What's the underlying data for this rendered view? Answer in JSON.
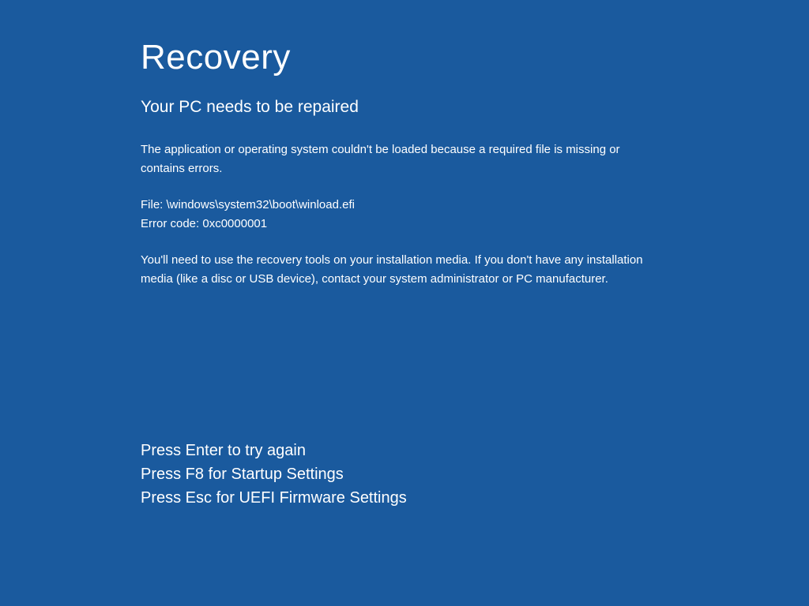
{
  "colors": {
    "background": "#1a5a9e",
    "text": "#ffffff"
  },
  "title": "Recovery",
  "subtitle": "Your PC needs to be repaired",
  "description": "The application or operating system couldn't be loaded because a required file is missing or contains errors.",
  "file_label": "File: ",
  "file_path": "\\windows\\system32\\boot\\winload.efi",
  "error_label": "Error code: ",
  "error_code": "0xc0000001",
  "recovery_hint": "You'll need to use the recovery tools on your installation media. If you don't have any installation media (like a disc or USB device), contact your system administrator or PC manufacturer.",
  "actions": {
    "enter": "Press Enter to try again",
    "f8": "Press F8 for Startup Settings",
    "esc": "Press Esc for UEFI Firmware Settings"
  }
}
